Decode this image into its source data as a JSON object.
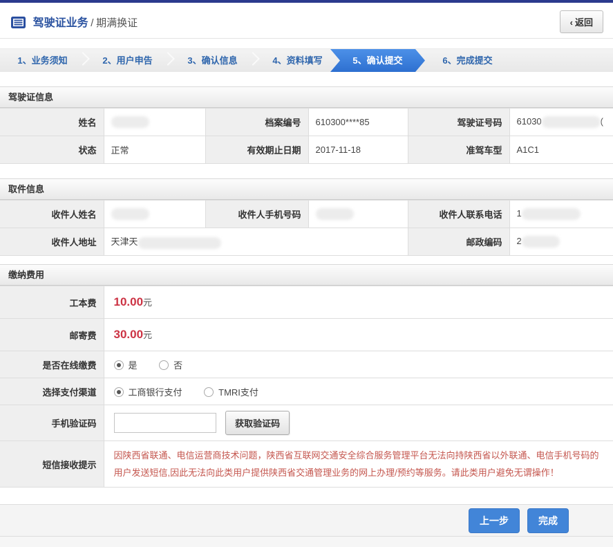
{
  "header": {
    "title": "驾驶证业务",
    "separator": "/",
    "subtitle": "期满换证",
    "back_arrow": "‹",
    "back_label": "返回"
  },
  "steps": {
    "items": [
      {
        "label": "1、业务须知",
        "active": false
      },
      {
        "label": "2、用户申告",
        "active": false
      },
      {
        "label": "3、确认信息",
        "active": false
      },
      {
        "label": "4、资料填写",
        "active": false
      },
      {
        "label": "5、确认提交",
        "active": true
      },
      {
        "label": "6、完成提交",
        "active": false
      }
    ]
  },
  "license_section": {
    "title": "驾驶证信息",
    "rows": [
      [
        {
          "label": "姓名",
          "value": "",
          "redacted": true
        },
        {
          "label": "档案编号",
          "value": "610300****85",
          "redacted": false
        },
        {
          "label": "驾驶证号码",
          "value": "61030",
          "value_suffix": "(",
          "redacted": true
        }
      ],
      [
        {
          "label": "状态",
          "value": "正常",
          "redacted": false
        },
        {
          "label": "有效期止日期",
          "value": "2017-11-18",
          "redacted": false
        },
        {
          "label": "准驾车型",
          "value": "A1C1",
          "redacted": false
        }
      ]
    ]
  },
  "pickup_section": {
    "title": "取件信息",
    "row1": [
      {
        "label": "收件人姓名",
        "value": "",
        "redacted": true
      },
      {
        "label": "收件人手机号码",
        "value": "",
        "redacted": true
      },
      {
        "label": "收件人联系电话",
        "value": "1",
        "redacted": true
      }
    ],
    "row2": [
      {
        "label": "收件人地址",
        "value": "天津天",
        "redacted": true
      },
      {
        "label": "邮政编码",
        "value": "2",
        "redacted": true
      }
    ]
  },
  "fees_section": {
    "title": "缴纳费用",
    "cost_label": "工本费",
    "cost_value": "10.00",
    "cost_unit": "元",
    "postage_label": "邮寄费",
    "postage_value": "30.00",
    "postage_unit": "元",
    "online_pay_label": "是否在线缴费",
    "online_yes": "是",
    "online_no": "否",
    "online_selected": "是",
    "channel_label": "选择支付渠道",
    "channel_icbc": "工商银行支付",
    "channel_tmri": "TMRI支付",
    "channel_selected": "工商银行支付",
    "sms_code_label": "手机验证码",
    "sms_input_value": "",
    "get_code_button": "获取验证码",
    "notice_label": "短信接收提示",
    "notice_text": "因陕西省联通、电信运营商技术问题，陕西省互联网交通安全综合服务管理平台无法向持陕西省以外联通、电信手机号码的用户发送短信,因此无法向此类用户提供陕西省交通管理业务的网上办理/预约等服务。请此类用户避免无谓操作！"
  },
  "footer": {
    "prev_button": "上一步",
    "finish_button": "完成"
  },
  "colors": {
    "top_bar": "#2b3a8e",
    "title_blue": "#2a52a0",
    "step_text_blue": "#2f66ad",
    "active_step_blue": "#2e70d0",
    "fee_red": "#cc3344",
    "notice_red": "#c4564e",
    "action_button_blue": "#4285d8",
    "label_cell_gray": "#efefef"
  }
}
